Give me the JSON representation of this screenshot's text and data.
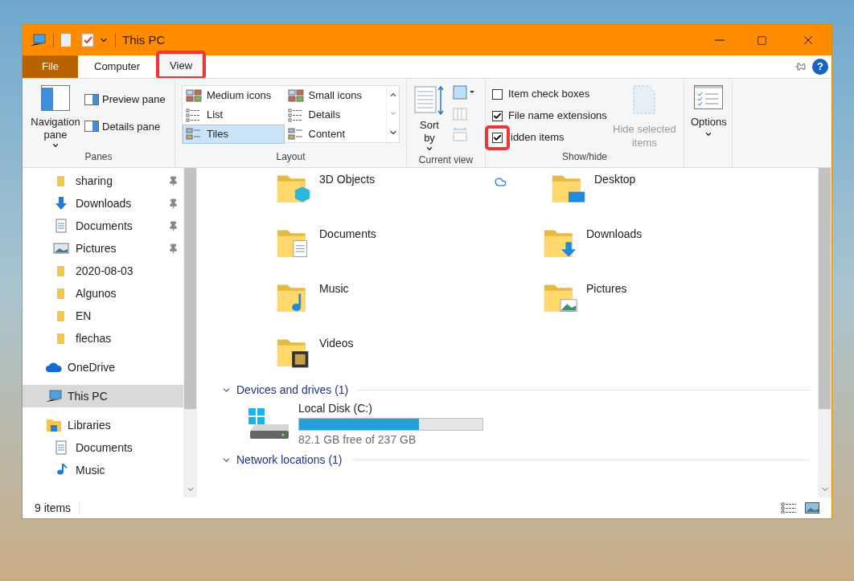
{
  "window": {
    "title": "This PC"
  },
  "ribbon_tabs": [
    {
      "label": "File",
      "kind": "file",
      "selected": false,
      "annotated": false
    },
    {
      "label": "Computer",
      "kind": "tab",
      "selected": false,
      "annotated": false
    },
    {
      "label": "View",
      "kind": "tab",
      "selected": true,
      "annotated": true
    }
  ],
  "help": "?",
  "ribbon": {
    "panes": {
      "title": "Panes",
      "navigation_pane": "Navigation pane",
      "preview_pane": "Preview pane",
      "details_pane": "Details pane"
    },
    "layout": {
      "title": "Layout",
      "options": [
        {
          "label": "Medium icons",
          "kind": "medium",
          "selected": false
        },
        {
          "label": "Small icons",
          "kind": "small",
          "selected": false
        },
        {
          "label": "List",
          "kind": "list",
          "selected": false
        },
        {
          "label": "Details",
          "kind": "details",
          "selected": false
        },
        {
          "label": "Tiles",
          "kind": "tiles",
          "selected": true
        },
        {
          "label": "Content",
          "kind": "content",
          "selected": false
        }
      ]
    },
    "current_view": {
      "title": "Current view",
      "sort_by": "Sort by"
    },
    "show_hide": {
      "title": "Show/hide",
      "checkboxes": [
        {
          "label": "Item check boxes",
          "checked": false,
          "annotated": false
        },
        {
          "label": "File name extensions",
          "checked": true,
          "annotated": false
        },
        {
          "label": "idden items",
          "checked": true,
          "annotated": true
        }
      ],
      "hide_selected": "Hide selected items"
    },
    "options": {
      "label": "Options"
    }
  },
  "navigation": {
    "quick_access": [
      {
        "label": "sharing",
        "kind": "folder",
        "pinned": true
      },
      {
        "label": "Downloads",
        "kind": "downloads",
        "pinned": true
      },
      {
        "label": "Documents",
        "kind": "documents",
        "pinned": true
      },
      {
        "label": "Pictures",
        "kind": "pictures",
        "pinned": true
      },
      {
        "label": "2020-08-03",
        "kind": "folder",
        "pinned": false
      },
      {
        "label": "Algunos",
        "kind": "folder",
        "pinned": false
      },
      {
        "label": "EN",
        "kind": "folder",
        "pinned": false
      },
      {
        "label": "flechas",
        "kind": "folder",
        "pinned": false
      }
    ],
    "locations": [
      {
        "label": "OneDrive",
        "kind": "cloud",
        "selected": false
      },
      {
        "label": "This PC",
        "kind": "pc",
        "selected": true
      },
      {
        "label": "Libraries",
        "kind": "libraries",
        "selected": false,
        "children": [
          {
            "label": "Documents",
            "kind": "documents",
            "selected": false
          },
          {
            "label": "Music",
            "kind": "music",
            "selected": false
          }
        ]
      }
    ]
  },
  "folders": [
    {
      "name": "3D Objects",
      "kind": "objects",
      "cloud": false
    },
    {
      "name": "Desktop",
      "kind": "desktop",
      "cloud": true
    },
    {
      "name": "Documents",
      "kind": "documents",
      "cloud": false
    },
    {
      "name": "Downloads",
      "kind": "downloads",
      "cloud": false
    },
    {
      "name": "Music",
      "kind": "music",
      "cloud": false
    },
    {
      "name": "Pictures",
      "kind": "pictures",
      "cloud": false
    },
    {
      "name": "Videos",
      "kind": "videos",
      "cloud": false
    }
  ],
  "devices": {
    "header": "Devices and drives (1)",
    "expanded": true,
    "drives": [
      {
        "name": "Local Disk (C:)",
        "level": 0.654,
        "free": "82.1 GB free of 237 GB"
      }
    ]
  },
  "network": {
    "header": "Network locations (1)",
    "expanded": true
  },
  "status_bar": {
    "count": "9 items"
  }
}
